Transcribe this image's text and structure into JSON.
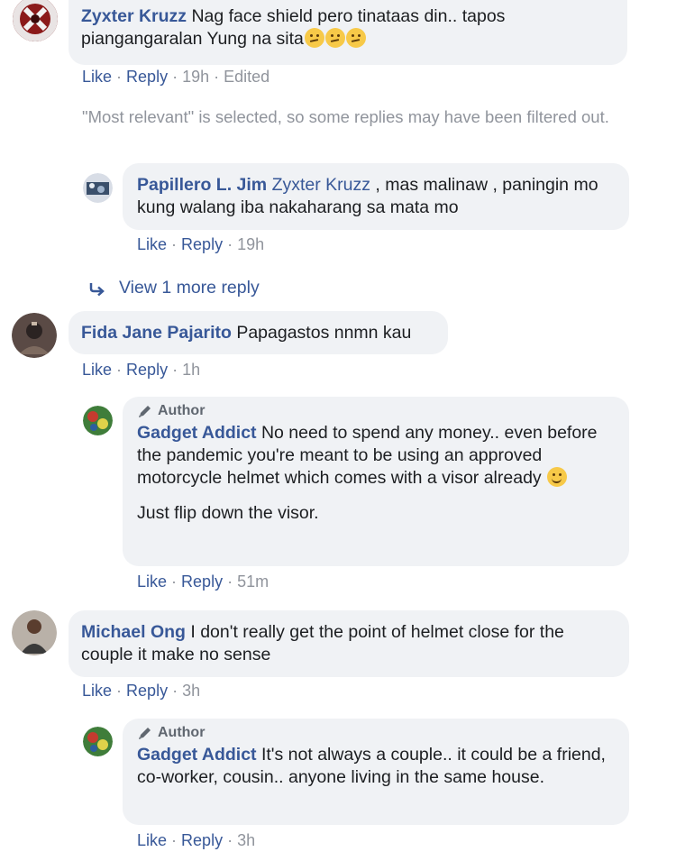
{
  "comments": [
    {
      "name": "Zyxter Kruzz",
      "text": "Nag face shield pero tinataas din.. tapos piangangaralan Yung na sita",
      "actions": {
        "like": "Like",
        "reply": "Reply",
        "time": "19h",
        "edited": "Edited"
      }
    },
    {
      "name": "Fida Jane Pajarito",
      "text": "Papagastos nnmn kau",
      "actions": {
        "like": "Like",
        "reply": "Reply",
        "time": "1h"
      }
    },
    {
      "name": "Michael Ong",
      "text": "I don't really get the point of helmet close for the couple it make no sense",
      "actions": {
        "like": "Like",
        "reply": "Reply",
        "time": "3h"
      }
    }
  ],
  "notice": "\"Most relevant\" is selected, so some replies may have been filtered out.",
  "replies": [
    {
      "name": "Papillero L. Jim",
      "mention": "Zyxter Kruzz",
      "text": ", mas malinaw , paningin mo kung walang iba nakaharang sa mata mo",
      "actions": {
        "like": "Like",
        "reply": "Reply",
        "time": "19h"
      }
    },
    {
      "badge": "Author",
      "name": "Gadget Addict",
      "text": "No need to spend any money.. even before the pandemic you're meant to be using an approved motorcycle helmet which comes with a visor already",
      "text2": "Just flip down the visor.",
      "actions": {
        "like": "Like",
        "reply": "Reply",
        "time": "51m"
      }
    },
    {
      "badge": "Author",
      "name": "Gadget Addict",
      "text": "It's not always a couple.. it could be a friend, co-worker, cousin.. anyone living in the same house.",
      "actions": {
        "like": "Like",
        "reply": "Reply",
        "time": "3h"
      }
    }
  ],
  "view_more": "View 1 more reply",
  "icons": {
    "reply_arrow": "reply-arrow-icon",
    "author_badge": "pencil-icon"
  },
  "colors": {
    "link": "#385898",
    "bubble": "#f0f2f5",
    "meta": "#90949c"
  }
}
